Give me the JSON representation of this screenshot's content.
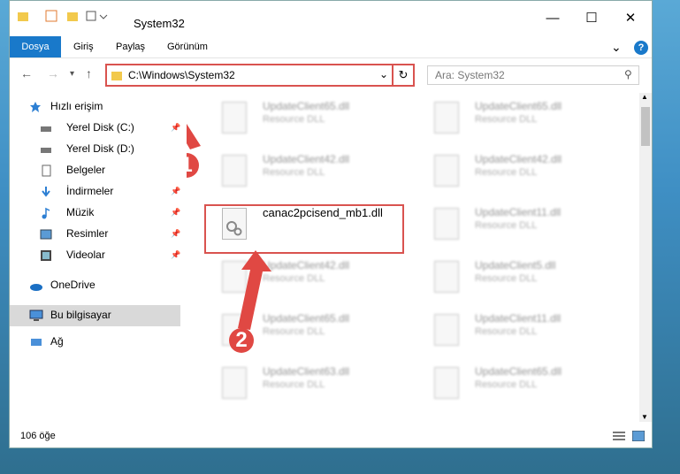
{
  "window": {
    "title": "System32"
  },
  "tabs": [
    "Dosya",
    "Giriş",
    "Paylaş",
    "Görünüm"
  ],
  "address": {
    "path": "C:\\Windows\\System32"
  },
  "search": {
    "placeholder": "Ara: System32"
  },
  "sidebar": {
    "items": [
      {
        "label": "Hızlı erişim",
        "icon": "star-icon"
      },
      {
        "label": "Yerel Disk (C:)",
        "icon": "drive-icon"
      },
      {
        "label": "Yerel Disk (D:)",
        "icon": "drive-icon"
      },
      {
        "label": "Belgeler",
        "icon": "document-icon"
      },
      {
        "label": "İndirmeler",
        "icon": "download-icon"
      },
      {
        "label": "Müzik",
        "icon": "music-icon"
      },
      {
        "label": "Resimler",
        "icon": "pictures-icon"
      },
      {
        "label": "Videolar",
        "icon": "video-icon"
      },
      {
        "label": "OneDrive",
        "icon": "cloud-icon"
      },
      {
        "label": "Bu bilgisayar",
        "icon": "computer-icon"
      },
      {
        "label": "Ağ",
        "icon": "network-icon"
      }
    ]
  },
  "files": [
    {
      "name": "UpdateClient65.dll",
      "type": "Resource DLL"
    },
    {
      "name": "UpdateClient65.dll",
      "type": "Resource DLL"
    },
    {
      "name": "UpdateClient42.dll",
      "type": "Resource DLL"
    },
    {
      "name": "UpdateClient42.dll",
      "type": "Resource DLL"
    },
    {
      "name": "canac2pcisend_mb1.dll",
      "type": ""
    },
    {
      "name": "UpdateClient11.dll",
      "type": "Resource DLL"
    },
    {
      "name": "UpdateClient42.dll",
      "type": "Resource DLL"
    },
    {
      "name": "UpdateClient5.dll",
      "type": "Resource DLL"
    },
    {
      "name": "UpdateClient65.dll",
      "type": "Resource DLL"
    },
    {
      "name": "UpdateClient11.dll",
      "type": "Resource DLL"
    },
    {
      "name": "UpdateClient63.dll",
      "type": "Resource DLL"
    },
    {
      "name": "UpdateClient65.dll",
      "type": "Resource DLL"
    }
  ],
  "status": {
    "count": "106 öğe"
  },
  "badges": [
    "1",
    "2"
  ],
  "colors": {
    "accent": "#1979ca",
    "highlight": "#d9534f"
  }
}
